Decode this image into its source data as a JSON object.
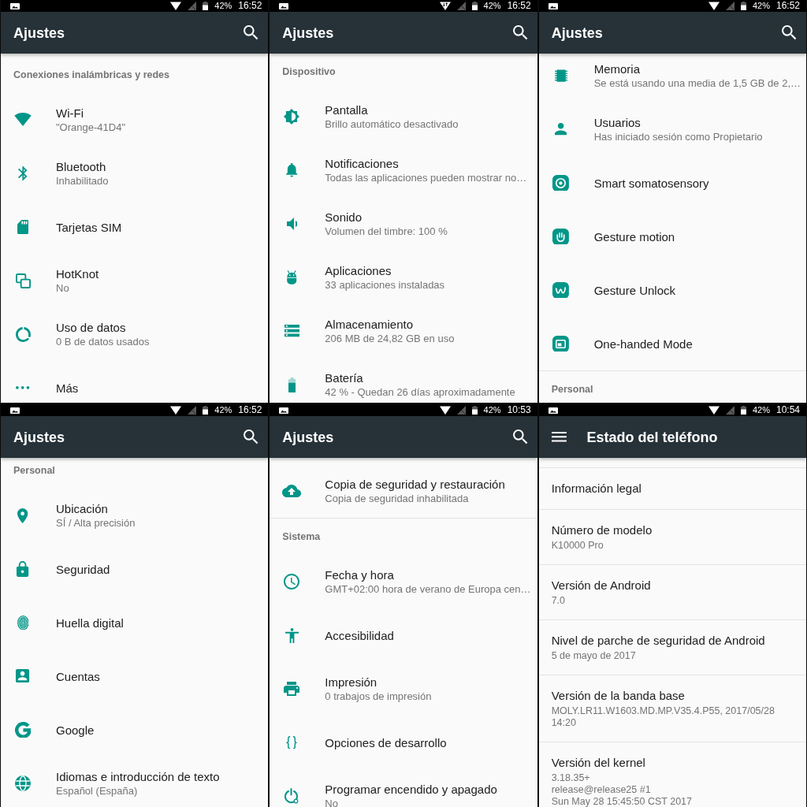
{
  "screens": [
    {
      "kind": "main",
      "status_bar": {
        "wifi_activity": false,
        "battery": "42%",
        "time": "16:52"
      },
      "app_bar": {
        "title": "Ajustes"
      },
      "sections": [
        {
          "header": "Conexiones inalámbricas y redes",
          "items": [
            {
              "title": "Wi-Fi",
              "summary": "\"Orange-41D4\""
            },
            {
              "title": "Bluetooth",
              "summary": "Inhabilitado"
            },
            {
              "title": "Tarjetas SIM"
            },
            {
              "title": "HotKnot",
              "summary": "No"
            },
            {
              "title": "Uso de datos",
              "summary": "0 B de datos usados"
            },
            {
              "title": "Más"
            }
          ]
        }
      ]
    },
    {
      "kind": "main",
      "status_bar": {
        "wifi_activity": true,
        "battery": "42%",
        "time": "16:52"
      },
      "app_bar": {
        "title": "Ajustes"
      },
      "sections": [
        {
          "header": "Dispositivo",
          "items": [
            {
              "title": "Pantalla",
              "summary": "Brillo automático desactivado"
            },
            {
              "title": "Notificaciones",
              "summary": "Todas las aplicaciones pueden mostrar no…"
            },
            {
              "title": "Sonido",
              "summary": "Volumen del timbre: 100 %"
            },
            {
              "title": "Aplicaciones",
              "summary": "33 aplicaciones instaladas"
            },
            {
              "title": "Almacenamiento",
              "summary": "206 MB de 24,82 GB en uso"
            },
            {
              "title": "Batería",
              "summary": "42 % - Quedan 26 días aproximadamente"
            }
          ]
        }
      ]
    },
    {
      "kind": "main",
      "status_bar": {
        "wifi_activity": false,
        "battery": "42%",
        "time": "16:52"
      },
      "app_bar": {
        "title": "Ajustes"
      },
      "sections": [
        {
          "items": [
            {
              "title": "Memoria",
              "summary": "Se está usando una media de 1,5 GB de 2,…"
            },
            {
              "title": "Usuarios",
              "summary": "Has iniciado sesión como Propietario"
            },
            {
              "title": "Smart somatosensory"
            },
            {
              "title": "Gesture motion"
            },
            {
              "title": "Gesture Unlock"
            },
            {
              "title": "One-handed Mode"
            }
          ]
        },
        {
          "header": "Personal"
        }
      ]
    },
    {
      "kind": "main",
      "status_bar": {
        "wifi_activity": false,
        "battery": "42%",
        "time": "16:52"
      },
      "app_bar": {
        "title": "Ajustes"
      },
      "sections": [
        {
          "header": "Personal",
          "items": [
            {
              "title": "Ubicación",
              "summary": "SÍ / Alta precisión"
            },
            {
              "title": "Seguridad"
            },
            {
              "title": "Huella digital"
            },
            {
              "title": "Cuentas"
            },
            {
              "title": "Google"
            },
            {
              "title": "Idiomas e introducción de texto",
              "summary": "Español (España)"
            }
          ]
        }
      ]
    },
    {
      "kind": "main",
      "status_bar": {
        "wifi_activity": false,
        "battery": "42%",
        "time": "10:53"
      },
      "app_bar": {
        "title": "Ajustes"
      },
      "sections": [
        {
          "items": [
            {
              "title": "Copia de seguridad y restauración",
              "summary": "Copia de seguridad inhabilitada"
            }
          ]
        },
        {
          "header": "Sistema",
          "items": [
            {
              "title": "Fecha y hora",
              "summary": "GMT+02:00 hora de verano de Europa cen…"
            },
            {
              "title": "Accesibilidad"
            },
            {
              "title": "Impresión",
              "summary": "0 trabajos de impresión"
            },
            {
              "title": "Opciones de desarrollo"
            },
            {
              "title": "Programar encendido y apagado",
              "summary": "No"
            }
          ]
        }
      ]
    },
    {
      "kind": "detail",
      "status_bar": {
        "wifi_activity": false,
        "battery": "42%",
        "time": "10:54"
      },
      "app_bar": {
        "title": "Estado del teléfono"
      },
      "sections": [
        {
          "items": [
            {
              "title": "Información legal"
            },
            {
              "title": "Número de modelo",
              "summary": "K10000 Pro"
            },
            {
              "title": "Versión de Android",
              "summary": "7.0"
            },
            {
              "title": "Nivel de parche de seguridad de Android",
              "summary": "5 de mayo de 2017"
            },
            {
              "title": "Versión de la banda base",
              "summary": "MOLY.LR11.W1603.MD.MP.V35.4.P55, 2017/05/28 14:20"
            },
            {
              "title": "Versión del kernel",
              "summary": "3.18.35+\nrelease@release25 #1\nSun May 28 15:45:50 CST 2017"
            }
          ]
        }
      ]
    }
  ]
}
